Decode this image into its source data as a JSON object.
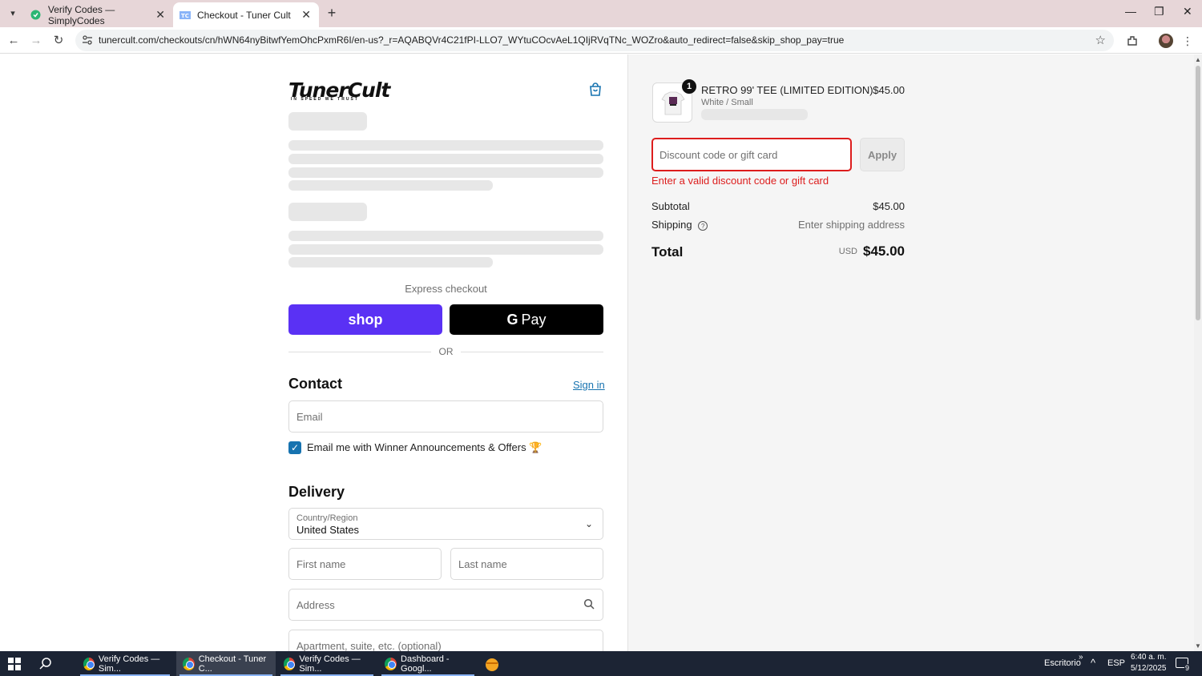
{
  "browser": {
    "tabs": [
      {
        "title": "Verify Codes — SimplyCodes"
      },
      {
        "title": "Checkout - Tuner Cult"
      }
    ],
    "url": "tunercult.com/checkouts/cn/hWN64nyBitwfYemOhcPxmR6I/en-us?_r=AQABQVr4C21fPI-LLO7_WYtuCOcvAeL1QIjRVqTNc_WOZro&auto_redirect=false&skip_shop_pay=true"
  },
  "checkout": {
    "brand": "TunerCult",
    "brand_tagline": "IN SPEED WE TRUST",
    "express_label": "Express checkout",
    "shop_label": "shop",
    "gpay_label": "Pay",
    "or_label": "OR",
    "contact_title": "Contact",
    "sign_in": "Sign in",
    "email_placeholder": "Email",
    "newsletter_label": "Email me with Winner Announcements & Offers 🏆",
    "newsletter_checked": true,
    "delivery_title": "Delivery",
    "country_label": "Country/Region",
    "country_value": "United States",
    "first_name_placeholder": "First name",
    "last_name_placeholder": "Last name",
    "address_placeholder": "Address",
    "apartment_placeholder": "Apartment, suite, etc. (optional)"
  },
  "summary": {
    "item": {
      "quantity": "1",
      "name": "RETRO 99' TEE (LIMITED EDITION)",
      "variant": "White / Small",
      "price": "$45.00"
    },
    "discount_placeholder": "Discount code or gift card",
    "apply_label": "Apply",
    "error": "Enter a valid discount code or gift card",
    "subtotal_label": "Subtotal",
    "subtotal_value": "$45.00",
    "shipping_label": "Shipping",
    "shipping_value": "Enter shipping address",
    "total_label": "Total",
    "total_currency": "USD",
    "total_value": "$45.00"
  },
  "taskbar": {
    "apps": [
      {
        "label": "Verify Codes — Sim..."
      },
      {
        "label": "Checkout - Tuner C..."
      },
      {
        "label": "Verify Codes — Sim..."
      },
      {
        "label": "Dashboard - Googl..."
      }
    ],
    "desktop_label": "Escritorio",
    "lang": "ESP",
    "time": "6:40 a. m.",
    "date": "5/12/2025",
    "notif_count": "9"
  },
  "colors": {
    "accent": "#1773b0",
    "error": "#dd1d1d",
    "shop_purple": "#5a31f4"
  }
}
